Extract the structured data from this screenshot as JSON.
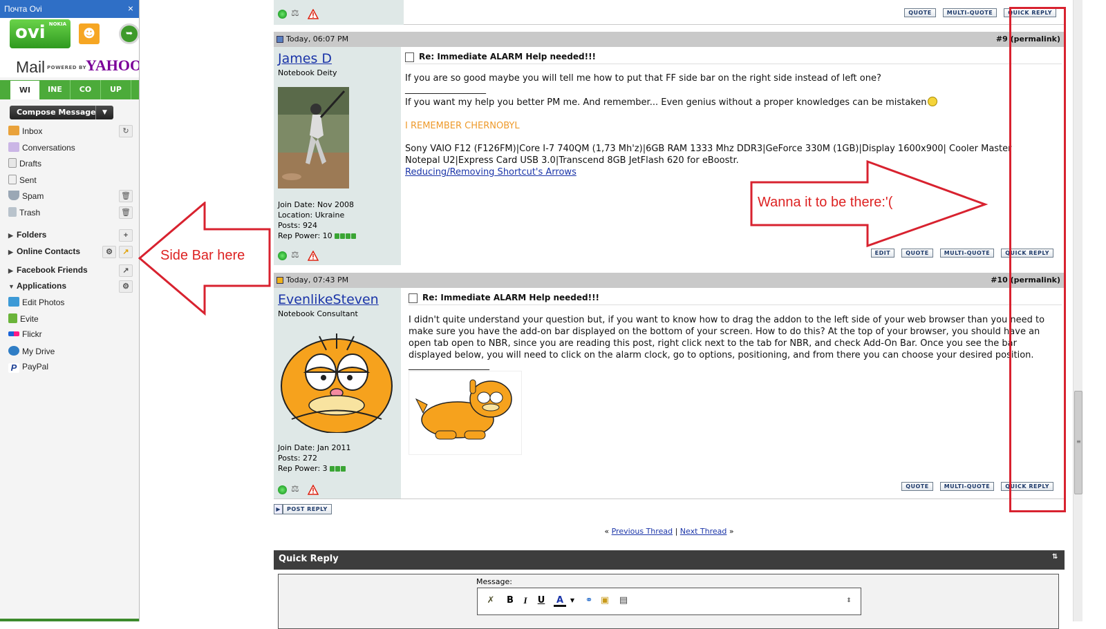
{
  "sidebar": {
    "title": "Почта Ovi",
    "close_glyph": "×",
    "brand_nokia": "NOKIA",
    "brand_ovi": "ovi",
    "mail_word": "Mail",
    "powered_by": "POWERED BY",
    "yahoo": "YAHOO",
    "tabs": [
      "WI",
      "INE",
      "CO",
      "UP"
    ],
    "compose_label": "Compose Message",
    "items": [
      {
        "label": "Inbox",
        "icon": "inbox-icon"
      },
      {
        "label": "Conversations",
        "icon": "conversations-icon"
      },
      {
        "label": "Drafts",
        "icon": "drafts-icon"
      },
      {
        "label": "Sent",
        "icon": "sent-icon"
      },
      {
        "label": "Spam",
        "icon": "spam-icon"
      },
      {
        "label": "Trash",
        "icon": "trash-icon"
      }
    ],
    "sections": [
      {
        "label": "Folders"
      },
      {
        "label": "Online Contacts"
      },
      {
        "label": "Facebook Friends"
      },
      {
        "label": "Applications"
      }
    ],
    "apps": [
      {
        "label": "Edit Photos",
        "icon": "edit-photos-icon"
      },
      {
        "label": "Evite",
        "icon": "evite-icon"
      },
      {
        "label": "Flickr",
        "icon": "flickr-icon"
      },
      {
        "label": "My Drive",
        "icon": "my-drive-icon"
      },
      {
        "label": "PayPal",
        "icon": "paypal-icon"
      }
    ]
  },
  "annotations": {
    "left_label": "Side Bar here",
    "right_label": "Wanna it to be there:'("
  },
  "buttons": {
    "quote": "QUOTE",
    "multi_quote": "MULTI-QUOTE",
    "quick_reply": "QUICK REPLY",
    "edit": "EDIT",
    "post_reply": "POST REPLY"
  },
  "posts": [
    {
      "date": "Today, 06:07 PM",
      "number": "#9",
      "permalink": "(permalink)",
      "username": "James D",
      "user_title": "Notebook Deity",
      "join_date": "Join Date: Nov 2008",
      "location": "Location: Ukraine",
      "posts": "Posts: 924",
      "rep_power": "Rep Power: 10",
      "title": "Re: Immediate ALARM Help needed!!!",
      "line1": "If you are so good maybe you will tell me how to put that FF side bar on the right side instead of left one?",
      "sig_rule": "__________________",
      "line2": "If you want my help you better PM me. And remember... Even genius without a proper knowledges can be mistaken",
      "chernobyl": "I REMEMBER CHERNOBYL",
      "specs1": "Sony VAIO F12 (F126FM)|Core I-7 740QM (1,73 Mh'z)|6GB RAM 1333 Mhz DDR3|GeForce 330M (1GB)|Display 1600x900| Cooler Master",
      "specs2": "Notepal U2|Express Card USB 3.0|Transcend 8GB JetFlash 620 for eBoostr.",
      "sig_link": "Reducing/Removing Shortcut's Arrows"
    },
    {
      "date": "Today, 07:43 PM",
      "number": "#10",
      "permalink": "(permalink)",
      "username": "EvenlikeSteven",
      "user_title": "Notebook Consultant",
      "join_date": "Join Date: Jan 2011",
      "posts": "Posts: 272",
      "rep_power": "Rep Power: 3",
      "title": "Re: Immediate ALARM Help needed!!!",
      "body1": "I didn't quite understand your question but, if you want to know how to drag the addon to the left side of your web browser than you need to",
      "body2": "make sure you have the add-on bar displayed on the bottom of your screen. How to do this? At the top of your browser, you should have an",
      "body3": "open tab open to NBR, since you are reading this post, right click next to the tab for NBR, and check Add-On Bar. Once you see the bar",
      "body4": "displayed below, you will need to click on the alarm clock, go to options, positioning, and from there you can choose your desired position.",
      "sig_rule": "__________________"
    }
  ],
  "thread_nav": {
    "left_quote": "«",
    "previous": "Previous Thread",
    "separator": "|",
    "next": "Next Thread",
    "right_quote": "»"
  },
  "quick_reply": {
    "title": "Quick Reply",
    "message_label": "Message:"
  }
}
